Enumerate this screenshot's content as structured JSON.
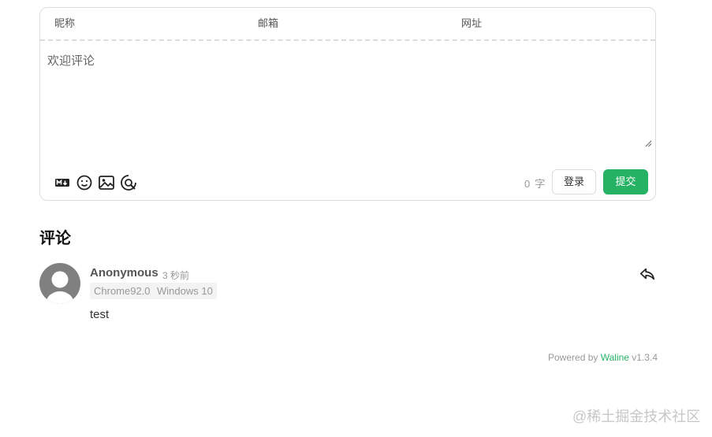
{
  "form": {
    "nick_label": "昵称",
    "mail_label": "邮箱",
    "link_label": "网址",
    "textarea_placeholder": "欢迎评论",
    "word_count": "0",
    "word_unit": "字",
    "login_label": "登录",
    "submit_label": "提交",
    "tool_icons": [
      "markdown-icon",
      "emoji-icon",
      "image-icon",
      "preview-icon"
    ]
  },
  "comments_section": {
    "title": "评论",
    "items": [
      {
        "nick": "Anonymous",
        "time": "3 秒前",
        "browser": "Chrome92.0",
        "os": "Windows 10",
        "content": "test"
      }
    ]
  },
  "footer": {
    "powered_prefix": "Powered by",
    "brand": "Waline",
    "version": "v1.3.4"
  },
  "watermark": "@稀土掘金技术社区",
  "colors": {
    "accent": "#25b264",
    "border": "#dddddd",
    "muted": "#999999"
  }
}
